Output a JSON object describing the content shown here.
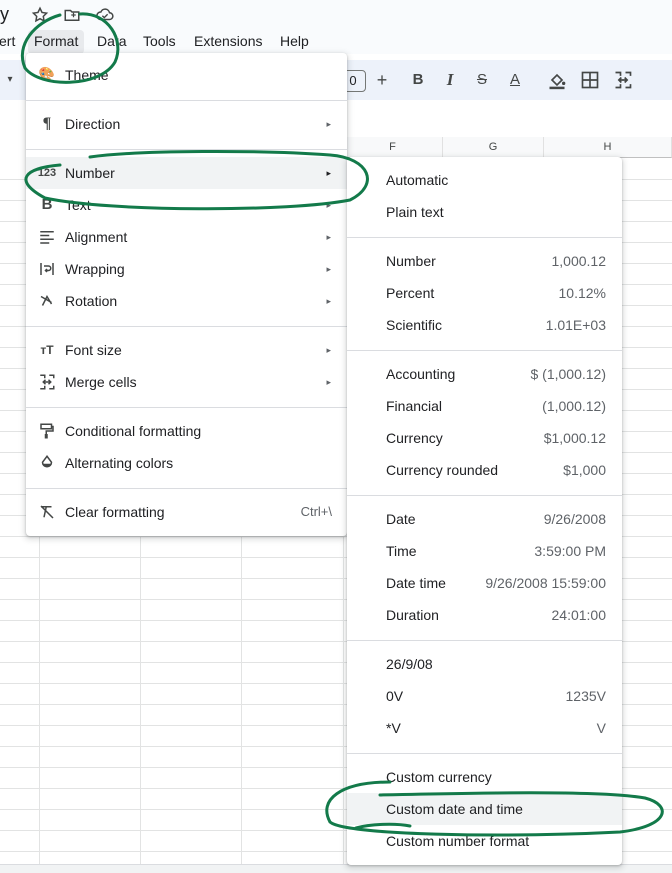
{
  "title_fragment": "y",
  "menubar": [
    "ert",
    "Format",
    "Data",
    "Tools",
    "Extensions",
    "Help"
  ],
  "toolbar": {
    "font_size": "0",
    "plus": "+",
    "bold": "B",
    "italic": "I",
    "strike": "S",
    "text_color": "A"
  },
  "columns": [
    "F",
    "G",
    "H"
  ],
  "format_menu": {
    "theme": "Theme",
    "direction": "Direction",
    "number": "Number",
    "text": "Text",
    "alignment": "Alignment",
    "wrapping": "Wrapping",
    "rotation": "Rotation",
    "font_size": "Font size",
    "merge_cells": "Merge cells",
    "conditional_formatting": "Conditional formatting",
    "alternating_colors": "Alternating colors",
    "clear_formatting": "Clear formatting",
    "clear_formatting_shortcut": "Ctrl+\\",
    "arrow": "▸",
    "number_icon": "123"
  },
  "number_menu": {
    "automatic": "Automatic",
    "plain_text": "Plain text",
    "items": [
      {
        "label": "Number",
        "example": "1,000.12"
      },
      {
        "label": "Percent",
        "example": "10.12%"
      },
      {
        "label": "Scientific",
        "example": "1.01E+03"
      },
      {
        "label": "Accounting",
        "example": "$ (1,000.12)"
      },
      {
        "label": "Financial",
        "example": "(1,000.12)"
      },
      {
        "label": "Currency",
        "example": "$1,000.12"
      },
      {
        "label": "Currency rounded",
        "example": "$1,000"
      },
      {
        "label": "Date",
        "example": "9/26/2008"
      },
      {
        "label": "Time",
        "example": "3:59:00 PM"
      },
      {
        "label": "Date time",
        "example": "9/26/2008 15:59:00"
      },
      {
        "label": "Duration",
        "example": "24:01:00"
      },
      {
        "label": "26/9/08",
        "example": ""
      },
      {
        "label": "0V",
        "example": "1235V"
      },
      {
        "label": "*V",
        "example": "V"
      }
    ],
    "custom_currency": "Custom currency",
    "custom_date_time": "Custom date and time",
    "custom_number_format": "Custom number format"
  },
  "colors": {
    "annotation": "#137a4a",
    "menubar_bg": "#f9fbfd",
    "toolbar_bg": "#edf2fa",
    "highlight": "#f1f3f4"
  }
}
